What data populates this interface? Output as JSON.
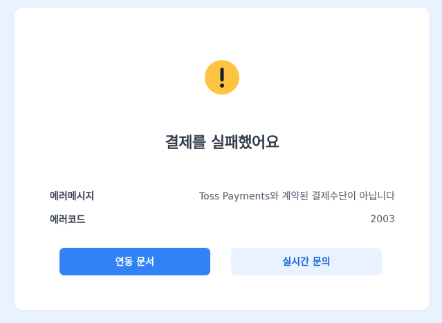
{
  "result": {
    "icon": "exclamation-icon",
    "title": "결제를 실패했어요"
  },
  "details": {
    "message_label": "에러메시지",
    "message_value": "Toss Payments와 계약된 결제수단이 아닙니다",
    "code_label": "에러코드",
    "code_value": "2003"
  },
  "actions": {
    "docs_label": "연동 문서",
    "inquiry_label": "실시간 문의"
  },
  "colors": {
    "background": "#e8f3ff",
    "warning": "#ffc342",
    "primary": "#3182f6",
    "secondary_bg": "#e8f3ff",
    "secondary_text": "#1b64da"
  }
}
